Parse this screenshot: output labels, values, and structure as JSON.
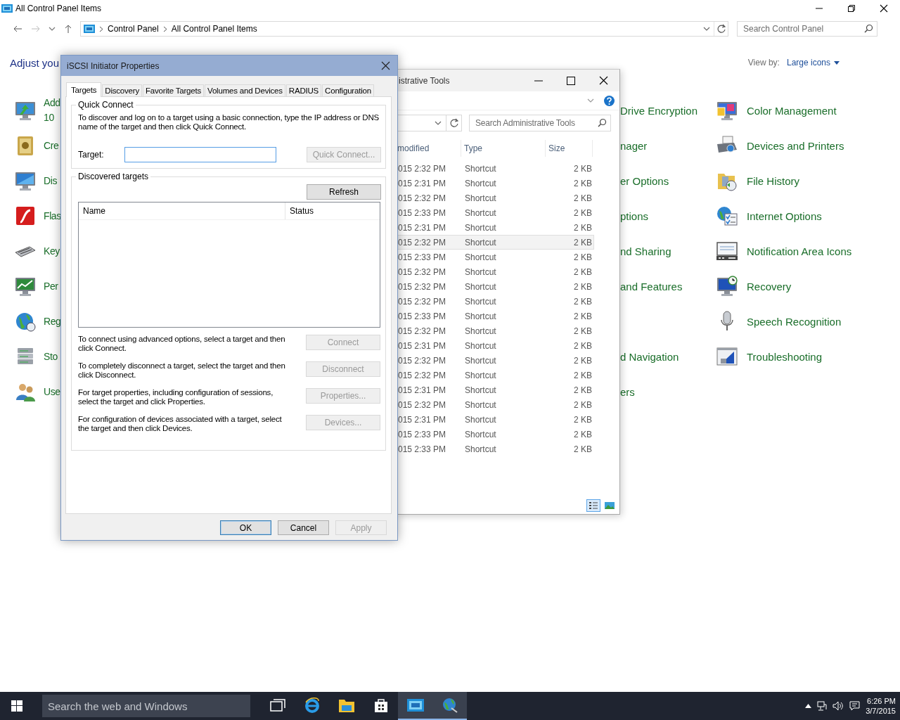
{
  "control_panel": {
    "title": "All Control Panel Items",
    "breadcrumb": [
      "Control Panel",
      "All Control Panel Items"
    ],
    "search_placeholder": "Search Control Panel",
    "heading": "Adjust you",
    "view_by_label": "View by:",
    "view_by_value": "Large icons",
    "rows": [
      {
        "left": "Add\n10",
        "middle": "Drive Encryption",
        "right": "Color Management"
      },
      {
        "left": "Cre",
        "middle": "nager",
        "right": "Devices and Printers"
      },
      {
        "left": "Dis",
        "middle": "er Options",
        "right": "File History"
      },
      {
        "left": "Flas",
        "middle": "ptions",
        "right": "Internet Options"
      },
      {
        "left": "Key",
        "middle": "nd Sharing",
        "right": "Notification Area Icons"
      },
      {
        "left": "Per",
        "middle": "and Features",
        "right": "Recovery"
      },
      {
        "left": "Reg",
        "right": "Speech Recognition"
      },
      {
        "left": "Sto",
        "middle": "d Navigation",
        "right": "Troubleshooting"
      },
      {
        "left": "Use",
        "middle": "ers"
      }
    ]
  },
  "admin_tools": {
    "title": "istrative Tools",
    "search_placeholder": "Search Administrative Tools",
    "columns": [
      "modified",
      "Type",
      "Size"
    ],
    "rows": [
      {
        "modified": "015 2:32 PM",
        "type": "Shortcut",
        "size": "2 KB",
        "hovered": false
      },
      {
        "modified": "015 2:31 PM",
        "type": "Shortcut",
        "size": "2 KB",
        "hovered": false
      },
      {
        "modified": "015 2:32 PM",
        "type": "Shortcut",
        "size": "2 KB",
        "hovered": false
      },
      {
        "modified": "015 2:33 PM",
        "type": "Shortcut",
        "size": "2 KB",
        "hovered": false
      },
      {
        "modified": "015 2:31 PM",
        "type": "Shortcut",
        "size": "2 KB",
        "hovered": false
      },
      {
        "modified": "015 2:32 PM",
        "type": "Shortcut",
        "size": "2 KB",
        "hovered": true
      },
      {
        "modified": "015 2:33 PM",
        "type": "Shortcut",
        "size": "2 KB",
        "hovered": false
      },
      {
        "modified": "015 2:32 PM",
        "type": "Shortcut",
        "size": "2 KB",
        "hovered": false
      },
      {
        "modified": "015 2:32 PM",
        "type": "Shortcut",
        "size": "2 KB",
        "hovered": false
      },
      {
        "modified": "015 2:32 PM",
        "type": "Shortcut",
        "size": "2 KB",
        "hovered": false
      },
      {
        "modified": "015 2:33 PM",
        "type": "Shortcut",
        "size": "2 KB",
        "hovered": false
      },
      {
        "modified": "015 2:32 PM",
        "type": "Shortcut",
        "size": "2 KB",
        "hovered": false
      },
      {
        "modified": "015 2:31 PM",
        "type": "Shortcut",
        "size": "2 KB",
        "hovered": false
      },
      {
        "modified": "015 2:32 PM",
        "type": "Shortcut",
        "size": "2 KB",
        "hovered": false
      },
      {
        "modified": "015 2:32 PM",
        "type": "Shortcut",
        "size": "2 KB",
        "hovered": false
      },
      {
        "modified": "015 2:31 PM",
        "type": "Shortcut",
        "size": "2 KB",
        "hovered": false
      },
      {
        "modified": "015 2:32 PM",
        "type": "Shortcut",
        "size": "2 KB",
        "hovered": false
      },
      {
        "modified": "015 2:31 PM",
        "type": "Shortcut",
        "size": "2 KB",
        "hovered": false
      },
      {
        "modified": "015 2:33 PM",
        "type": "Shortcut",
        "size": "2 KB",
        "hovered": false
      },
      {
        "modified": "015 2:33 PM",
        "type": "Shortcut",
        "size": "2 KB",
        "hovered": false
      }
    ],
    "view_buttons": [
      {
        "selected": true
      },
      {
        "selected": false
      }
    ]
  },
  "dialog": {
    "title": "iSCSI Initiator Properties",
    "tabs": [
      {
        "label": "Targets",
        "selected": true
      },
      {
        "label": "Discovery",
        "selected": false
      },
      {
        "label": "Favorite Targets",
        "selected": false
      },
      {
        "label": "Volumes and Devices",
        "selected": false
      },
      {
        "label": "RADIUS",
        "selected": false
      },
      {
        "label": "Configuration",
        "selected": false
      }
    ],
    "quick_connect": {
      "legend": "Quick Connect",
      "description": "To discover and log on to a target using a basic connection, type the IP address or DNS name of the target and then click Quick Connect.",
      "target_label": "Target:",
      "button": {
        "label": "Quick Connect...",
        "disabled": true
      }
    },
    "discovered": {
      "legend": "Discovered targets",
      "refresh_button": {
        "label": "Refresh",
        "disabled": false
      },
      "list_columns": [
        "Name",
        "Status"
      ],
      "actions": [
        {
          "text": "To connect using advanced options, select a target and then click Connect.",
          "button": {
            "label": "Connect",
            "disabled": true
          }
        },
        {
          "text": "To completely disconnect a target, select the target and then click Disconnect.",
          "button": {
            "label": "Disconnect",
            "disabled": true
          }
        },
        {
          "text": "For target properties, including configuration of sessions, select the target and click Properties.",
          "button": {
            "label": "Properties...",
            "disabled": true
          }
        },
        {
          "text": "For configuration of devices associated with a target, select the target and then click Devices.",
          "button": {
            "label": "Devices...",
            "disabled": true
          }
        }
      ]
    },
    "footer_buttons": [
      {
        "label": "OK",
        "default": true,
        "disabled": false
      },
      {
        "label": "Cancel",
        "default": false,
        "disabled": false
      },
      {
        "label": "Apply",
        "default": false,
        "disabled": true
      }
    ]
  },
  "taskbar": {
    "search_placeholder": "Search the web and Windows",
    "apps": [
      {
        "active": false
      },
      {
        "active": false
      },
      {
        "active": false
      },
      {
        "active": false
      },
      {
        "active": true
      },
      {
        "active": true
      }
    ],
    "time": "6:26 PM",
    "date": "3/7/2015"
  }
}
